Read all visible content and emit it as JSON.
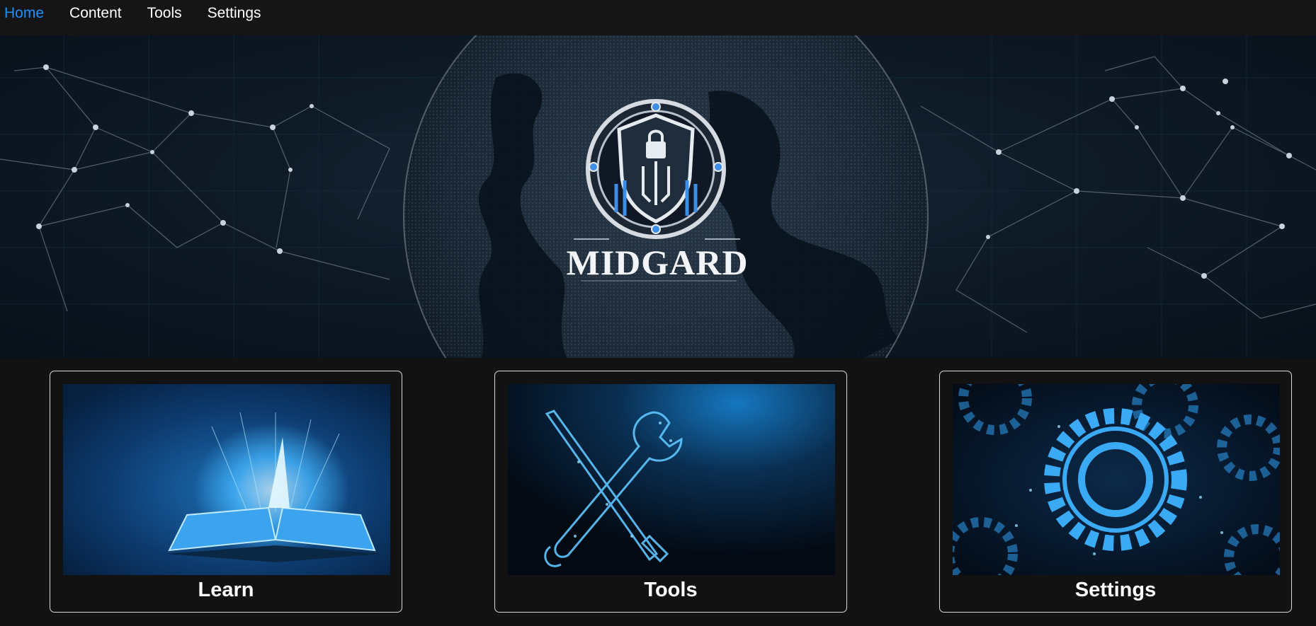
{
  "nav": {
    "items": [
      {
        "label": "Home",
        "active": true
      },
      {
        "label": "Content",
        "active": false
      },
      {
        "label": "Tools",
        "active": false
      },
      {
        "label": "Settings",
        "active": false
      }
    ],
    "active_color": "#1e90ff"
  },
  "hero": {
    "brand_name": "MIDGARD",
    "logo_icon": "shield-lock-circuit-emblem",
    "background": "globe-network-image"
  },
  "cards": [
    {
      "title": "Learn",
      "image": "glowing-open-book-image"
    },
    {
      "title": "Tools",
      "image": "wrench-and-screwdriver-image"
    },
    {
      "title": "Settings",
      "image": "gears-image"
    }
  ],
  "colors": {
    "page_background": "#121212",
    "accent_blue": "#1e90ff",
    "card_border": "#d8d8d8"
  }
}
